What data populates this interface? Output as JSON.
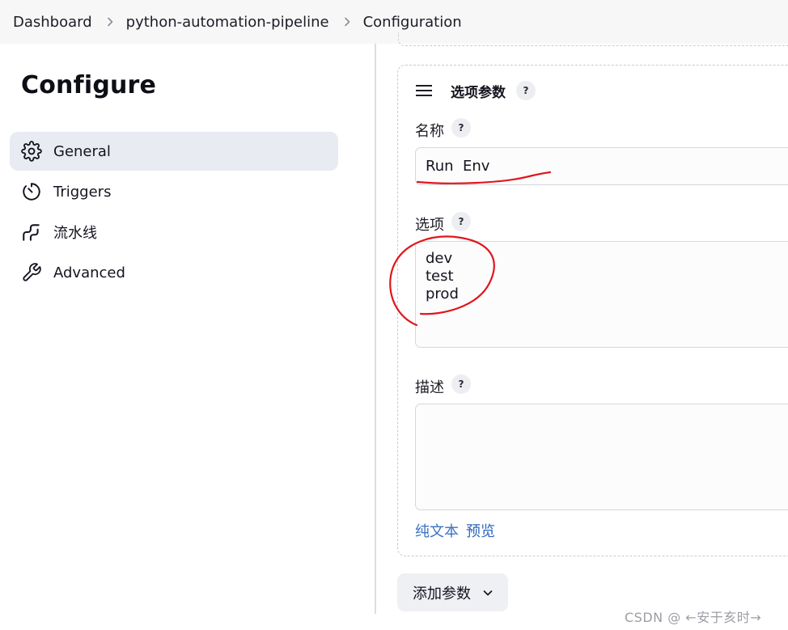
{
  "breadcrumb": {
    "items": [
      "Dashboard",
      "python-automation-pipeline",
      "Configuration"
    ]
  },
  "page": {
    "title": "Configure"
  },
  "sidebar": {
    "items": [
      {
        "label": "General",
        "icon": "gear-icon",
        "active": true
      },
      {
        "label": "Triggers",
        "icon": "timer-icon",
        "active": false
      },
      {
        "label": "流水线",
        "icon": "pipeline-icon",
        "active": false
      },
      {
        "label": "Advanced",
        "icon": "wrench-icon",
        "active": false
      }
    ]
  },
  "parameter": {
    "title": "选项参数",
    "help": "?",
    "name_label": "名称",
    "name_value": "Run  Env",
    "options_label": "选项",
    "options": [
      "dev",
      "test",
      "prod"
    ],
    "description_label": "描述",
    "description_value": "",
    "plain_text_link": "纯文本",
    "preview_link": "预览"
  },
  "actions": {
    "add_parameter": "添加参数"
  },
  "annotations": {
    "color": "#e0161b"
  },
  "watermark": "CSDN @ ←安于亥时→"
}
